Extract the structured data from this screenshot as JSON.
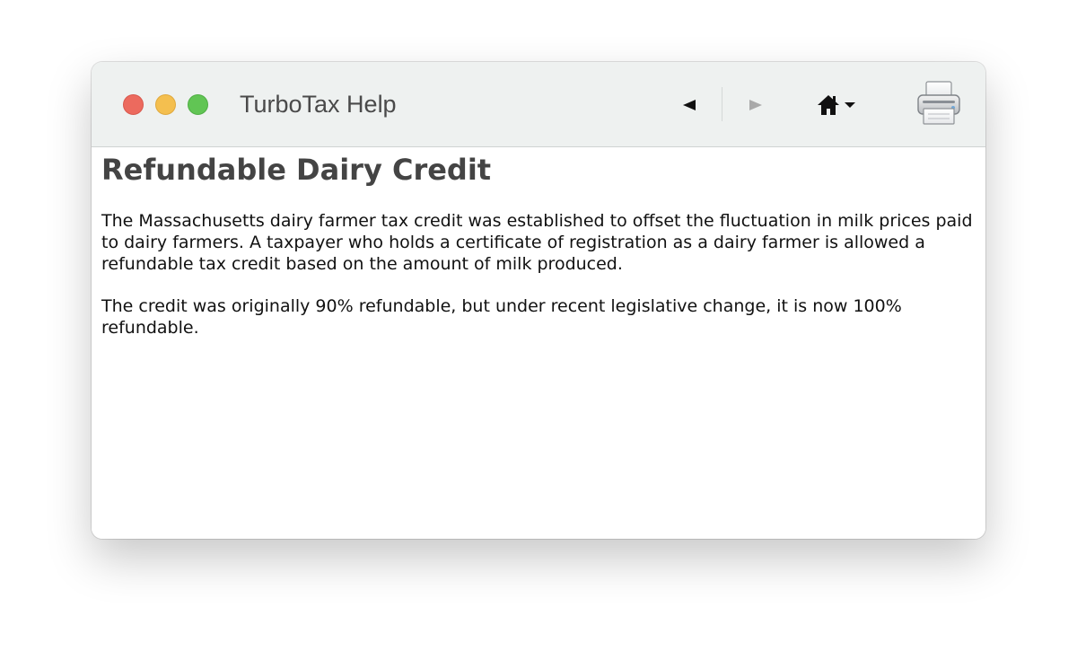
{
  "window": {
    "title": "TurboTax Help"
  },
  "toolbar": {
    "back_icon": "back-arrow-icon",
    "forward_icon": "forward-arrow-icon",
    "home_icon": "home-icon",
    "home_menu_icon": "chevron-down-icon",
    "print_icon": "printer-icon"
  },
  "article": {
    "heading": "Refundable Dairy Credit",
    "paragraphs": [
      "The Massachusetts dairy farmer tax credit was established to offset the fluctuation in milk prices paid to dairy farmers. A taxpayer who holds a certificate of registration as a dairy farmer is allowed a refundable tax credit based on the amount of milk produced.",
      "The credit was originally 90% refundable, but under recent legislative change, it is now 100% refundable."
    ]
  },
  "colors": {
    "close": "#ec6a5e",
    "minimize": "#f4bf4f",
    "maximize": "#61c554",
    "titlebar_bg": "#eef1f0",
    "heading": "#444444",
    "body_text": "#111111"
  }
}
